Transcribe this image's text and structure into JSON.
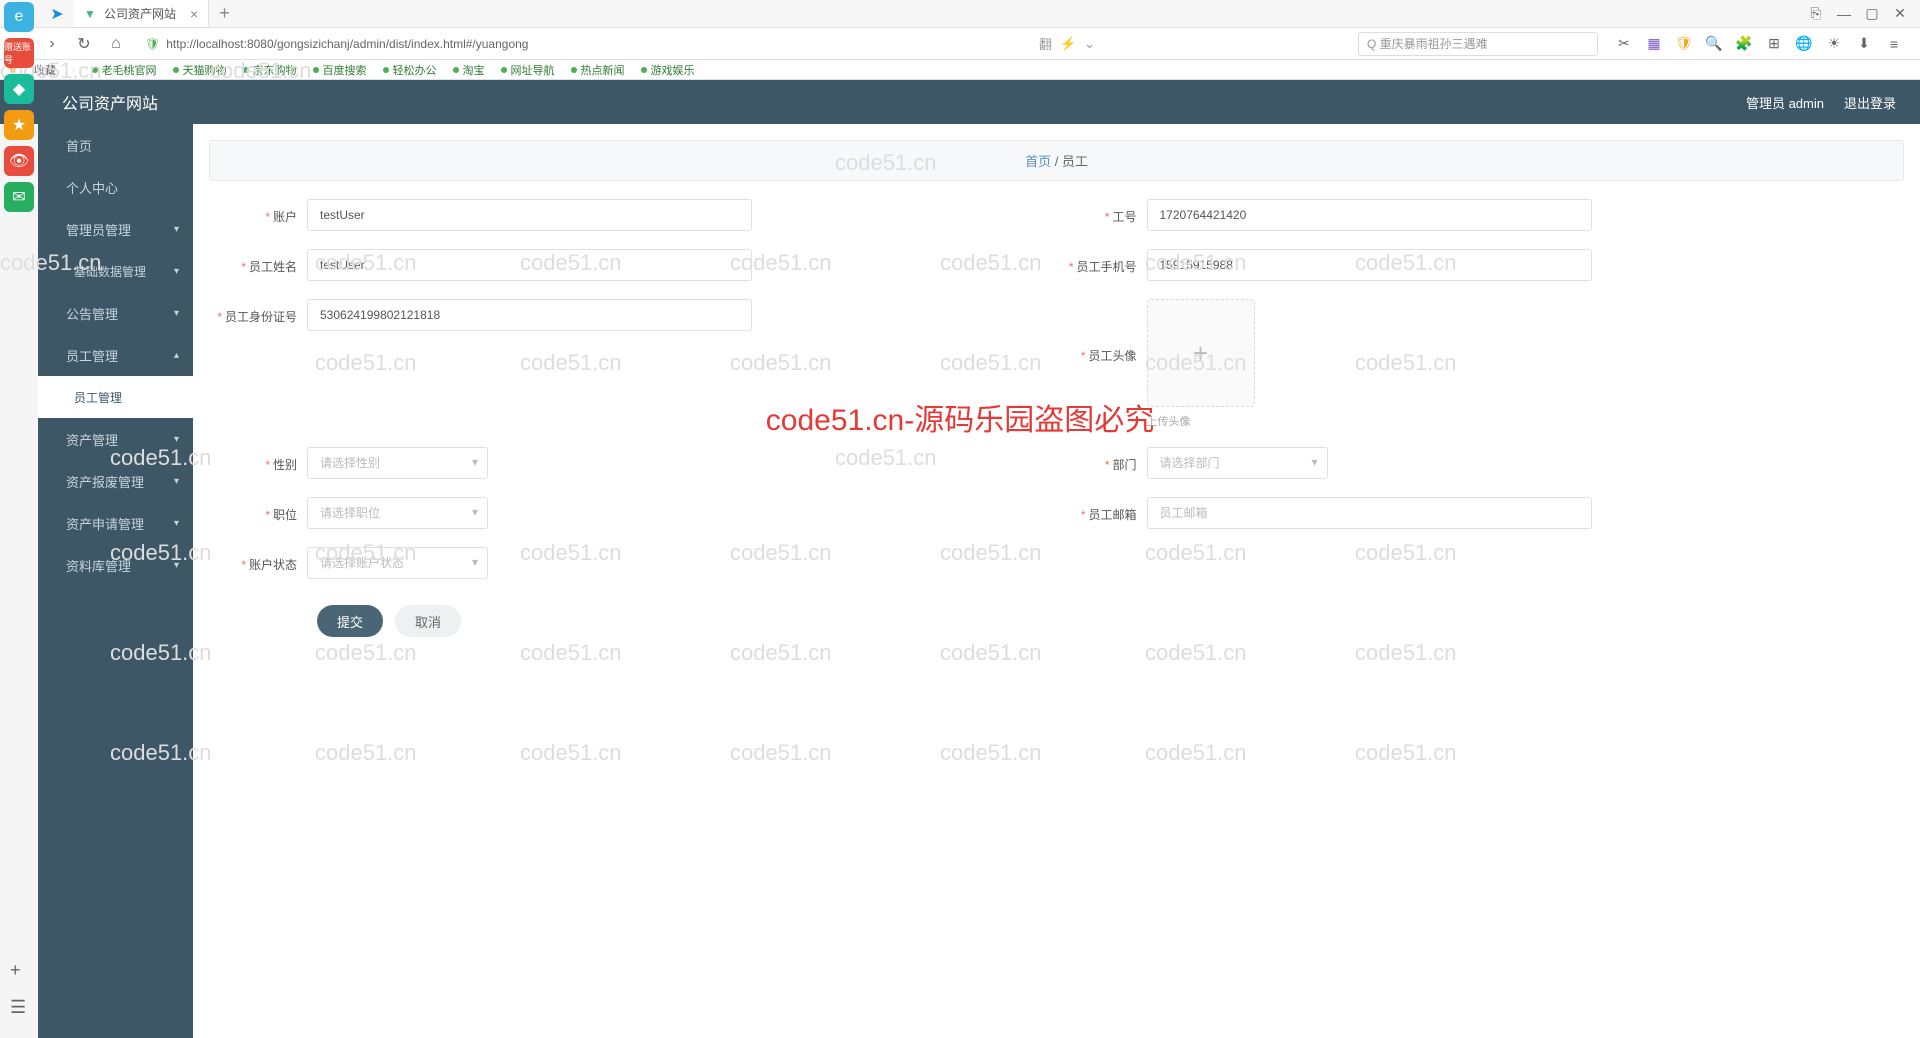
{
  "browser": {
    "tab_title": "公司资产网站",
    "url": "http://localhost:8080/gongsizichanj/admin/dist/index.html#/yuangong",
    "search_placeholder": "重庆暴雨祖孙三遇难",
    "bookmarks_label": "收藏",
    "bookmarks": [
      "老毛桃官网",
      "天猫购物",
      "京东购物",
      "百度搜索",
      "轻松办公",
      "淘宝",
      "网址导航",
      "热点新闻",
      "游戏娱乐"
    ]
  },
  "app": {
    "title": "公司资产网站",
    "admin_label": "管理员 admin",
    "logout_label": "退出登录"
  },
  "sidebar": {
    "items": [
      {
        "label": "首页"
      },
      {
        "label": "个人中心"
      },
      {
        "label": "管理员管理"
      },
      {
        "label": "基础数据管理"
      },
      {
        "label": "公告管理"
      },
      {
        "label": "员工管理"
      },
      {
        "label": "员工管理",
        "active": true
      },
      {
        "label": "资产管理"
      },
      {
        "label": "资产报废管理"
      },
      {
        "label": "资产申请管理"
      },
      {
        "label": "资料库管理"
      }
    ]
  },
  "breadcrumb": {
    "home": "首页",
    "current": "员工"
  },
  "form": {
    "account_label": "账户",
    "account_value": "testUser",
    "work_id_label": "工号",
    "work_id_value": "1720764421420",
    "name_label": "员工姓名",
    "name_value": "testUser",
    "phone_label": "员工手机号",
    "phone_value": "15915915988",
    "idcard_label": "员工身份证号",
    "idcard_value": "530624199802121818",
    "avatar_label": "员工头像",
    "avatar_hint": "上传头像",
    "gender_label": "性别",
    "gender_placeholder": "请选择性别",
    "dept_label": "部门",
    "dept_placeholder": "请选择部门",
    "position_label": "职位",
    "position_placeholder": "请选择职位",
    "email_label": "员工邮箱",
    "email_placeholder": "员工邮箱",
    "status_label": "账户状态",
    "status_placeholder": "请选择账户状态",
    "submit_label": "提交",
    "cancel_label": "取消"
  },
  "watermark": {
    "text": "code51.cn",
    "red": "code51.cn-源码乐园盗图必究"
  }
}
